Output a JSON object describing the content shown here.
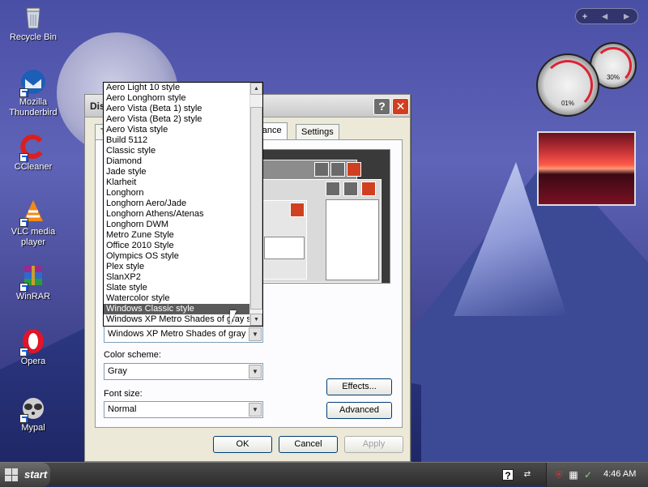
{
  "desktop": {
    "icons": [
      {
        "label": "Recycle Bin",
        "icon": "recycle-bin-icon"
      },
      {
        "label": "Mozilla\nThunderbird",
        "icon": "thunderbird-icon"
      },
      {
        "label": "CCleaner",
        "icon": "ccleaner-icon"
      },
      {
        "label": "VLC media\nplayer",
        "icon": "vlc-icon"
      },
      {
        "label": "WinRAR",
        "icon": "winrar-icon"
      },
      {
        "label": "Opera",
        "icon": "opera-icon"
      },
      {
        "label": "Mypal",
        "icon": "mypal-icon"
      }
    ]
  },
  "gadgets": {
    "sidebar_controls": [
      "+",
      "◄",
      "►"
    ],
    "cpu_meter": {
      "cpu_pct": "01%",
      "mem_pct": "30%"
    }
  },
  "dialog": {
    "title": "Dis",
    "tabs": [
      "T",
      "arance",
      "Settings"
    ],
    "color_scheme_label": "Color scheme:",
    "color_scheme_value": "Gray",
    "font_size_label": "Font size:",
    "font_size_value": "Normal",
    "style_value": "Windows XP Metro Shades of gray s",
    "effects_button": "Effects...",
    "advanced_button": "Advanced",
    "ok_button": "OK",
    "cancel_button": "Cancel",
    "apply_button": "Apply"
  },
  "dropdown": {
    "options": [
      "Aero Light 10 style",
      "Aero Longhorn style",
      "Aero Vista (Beta 1) style",
      "Aero Vista (Beta 2) style",
      "Aero Vista style",
      "Build 5112",
      "Classic style",
      "Diamond",
      "Jade style",
      "Klarheit",
      "Longhorn",
      "Longhorn Aero/Jade",
      "Longhorn Athens/Atenas",
      "Longhorn DWM",
      "Metro Zune Style",
      "Office 2010 Style",
      "Olympics OS style",
      "Plex style",
      "SlanXP2",
      "Slate style",
      "Watercolor style",
      "Windows Classic style",
      "Windows XP Metro Shades of gray st"
    ],
    "highlighted": "Windows Classic style"
  },
  "taskbar": {
    "start_label": "start",
    "clock": "4:46 AM"
  },
  "colors": {
    "highlight": "#5a5a5a",
    "close_button": "#d04020",
    "taskbar": "#2c2c2c"
  }
}
